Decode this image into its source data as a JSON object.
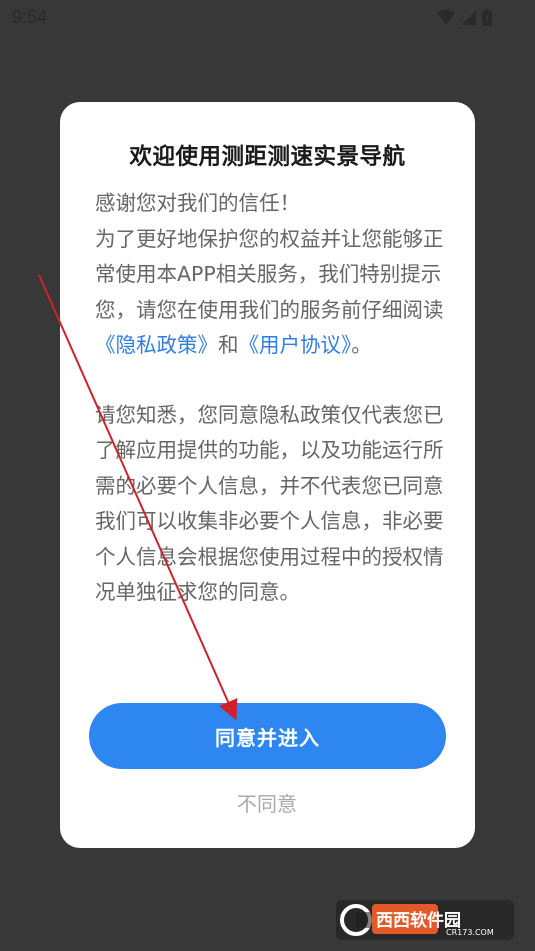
{
  "status_bar": {
    "time": "9:54",
    "icons": [
      "wifi-icon",
      "signal-icon",
      "battery-icon"
    ]
  },
  "dialog": {
    "title": "欢迎使用测距测速实景导航",
    "paragraph1": {
      "line_intro": "感谢您对我们的信任！",
      "text_before_links": "为了更好地保护您的权益并让您能够正常使用本APP相关服务，我们特别提示您，请您在使用我们的服务前仔细阅读",
      "privacy_link": "《隐私政策》",
      "conjunction": "和",
      "agreement_link": "《用户协议》",
      "ending": "。"
    },
    "paragraph2": "请您知悉，您同意隐私政策仅代表您已了解应用提供的功能，以及功能运行所需的必要个人信息，并不代表您已同意我们可以收集非必要个人信息，非必要个人信息会根据您使用过程中的授权情况单独征求您的同意。",
    "agree_button": "同意并进入",
    "disagree_button": "不同意"
  },
  "colors": {
    "overlay_background": "#383838",
    "dialog_background": "#ffffff",
    "primary_button": "#2e86f0",
    "link": "#2f7fe3",
    "body_text": "#666666",
    "annotation_arrow": "#d0202a"
  },
  "watermark": {
    "logo_text": "西西软件园",
    "domain_text": "CR173.COM"
  }
}
